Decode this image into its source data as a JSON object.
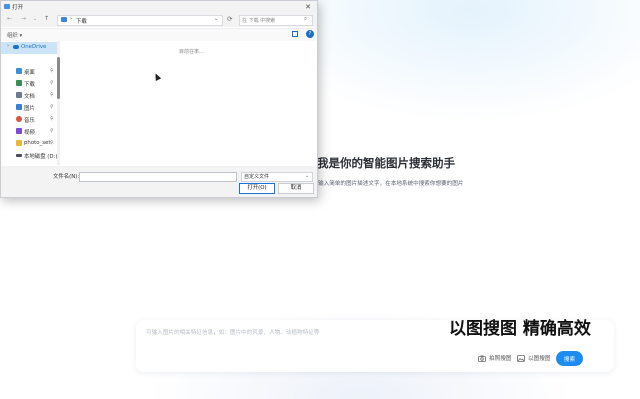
{
  "app": {
    "title": "我是你的智能图片搜索助手",
    "subtitle": "输入简单的图片描述文字，在本地系统中搜索你想要的图片",
    "search_placeholder": "可输入图片的相关特征信息，如：图片中的风景、人物、动植物特征等",
    "promo": "以图搜图 精确高效",
    "camera_label": "拍照搜图",
    "image_label": "以图搜图",
    "search_button": "搜索"
  },
  "dialog": {
    "title": "打开",
    "close_glyph": "✕",
    "address": {
      "crumb": "下载",
      "separator": "›"
    },
    "refresh_glyph": "⟳",
    "search_placeholder": "在 下载 中搜索",
    "organize_label": "组织 ▾",
    "empty_message": "目前在率…",
    "sidebar": [
      {
        "label": "OneDrive",
        "icon": "cloud-icon",
        "color": "#1e6fd0"
      },
      {
        "label": "桌面",
        "icon": "desktop-icon",
        "color": "#3d8fe0"
      },
      {
        "label": "下载",
        "icon": "download-icon",
        "color": "#3a8c57"
      },
      {
        "label": "文档",
        "icon": "document-icon",
        "color": "#6b7b90"
      },
      {
        "label": "图片",
        "icon": "picture-icon",
        "color": "#3a7fd8"
      },
      {
        "label": "音乐",
        "icon": "music-icon",
        "color": "#e0533b"
      },
      {
        "label": "视频",
        "icon": "video-icon",
        "color": "#7b4ad6"
      },
      {
        "label": "photo_set",
        "icon": "folder-icon",
        "color": "#e8b73a"
      },
      {
        "label": "本地磁盘 (D:)",
        "icon": "drive-icon",
        "color": "#4a4f57"
      }
    ],
    "pin_glyph": "📌",
    "filename_label": "文件名(N):",
    "filename_value": "",
    "filetype_label": "自定义文件",
    "open_button": "打开(O)",
    "cancel_button": "取消"
  },
  "colors": {
    "accent": "#1e8bf1"
  }
}
